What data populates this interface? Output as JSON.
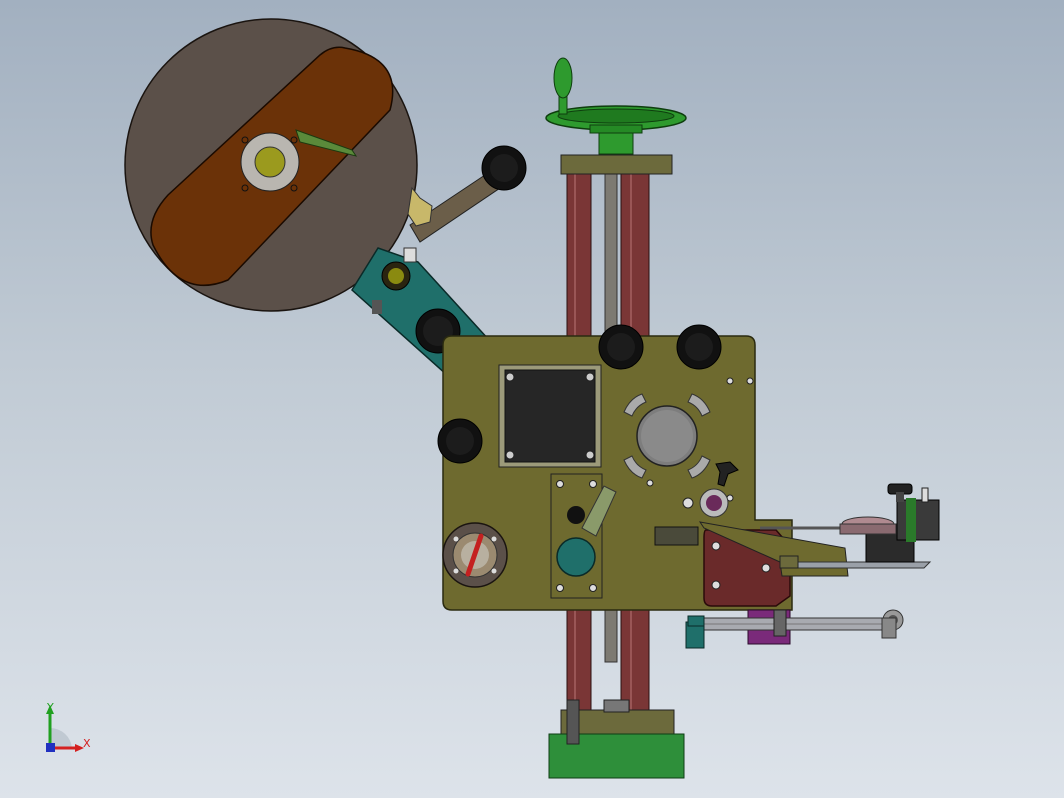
{
  "triad": {
    "x_label": "X",
    "y_label": "Y",
    "x_color": "#d42020",
    "y_color": "#20a020",
    "z_color": "#2030c0"
  },
  "colors": {
    "background_top": "#a2b0c0",
    "background_bottom": "#dde3ea",
    "reel": "#5b5049",
    "reel_slot": "#6b3208",
    "main_plate": "#6e6a2f",
    "column": "#7a3636",
    "handwheel": "#2e9a2e",
    "base": "#2e8f3a",
    "teal_bracket": "#1f6f6a",
    "motor": "#262626",
    "roller": "#111111",
    "peel_bracket": "#6a2a2a"
  }
}
